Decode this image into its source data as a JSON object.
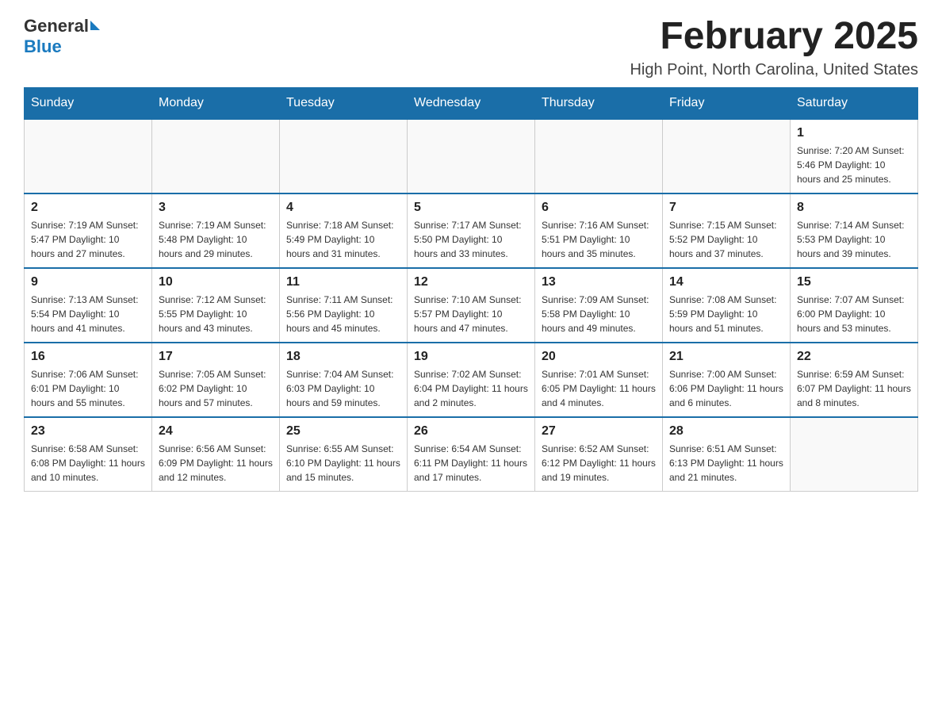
{
  "header": {
    "logo_general": "General",
    "logo_blue": "Blue",
    "month_title": "February 2025",
    "location": "High Point, North Carolina, United States"
  },
  "calendar": {
    "days_of_week": [
      "Sunday",
      "Monday",
      "Tuesday",
      "Wednesday",
      "Thursday",
      "Friday",
      "Saturday"
    ],
    "weeks": [
      [
        {
          "day": "",
          "info": ""
        },
        {
          "day": "",
          "info": ""
        },
        {
          "day": "",
          "info": ""
        },
        {
          "day": "",
          "info": ""
        },
        {
          "day": "",
          "info": ""
        },
        {
          "day": "",
          "info": ""
        },
        {
          "day": "1",
          "info": "Sunrise: 7:20 AM\nSunset: 5:46 PM\nDaylight: 10 hours and 25 minutes."
        }
      ],
      [
        {
          "day": "2",
          "info": "Sunrise: 7:19 AM\nSunset: 5:47 PM\nDaylight: 10 hours and 27 minutes."
        },
        {
          "day": "3",
          "info": "Sunrise: 7:19 AM\nSunset: 5:48 PM\nDaylight: 10 hours and 29 minutes."
        },
        {
          "day": "4",
          "info": "Sunrise: 7:18 AM\nSunset: 5:49 PM\nDaylight: 10 hours and 31 minutes."
        },
        {
          "day": "5",
          "info": "Sunrise: 7:17 AM\nSunset: 5:50 PM\nDaylight: 10 hours and 33 minutes."
        },
        {
          "day": "6",
          "info": "Sunrise: 7:16 AM\nSunset: 5:51 PM\nDaylight: 10 hours and 35 minutes."
        },
        {
          "day": "7",
          "info": "Sunrise: 7:15 AM\nSunset: 5:52 PM\nDaylight: 10 hours and 37 minutes."
        },
        {
          "day": "8",
          "info": "Sunrise: 7:14 AM\nSunset: 5:53 PM\nDaylight: 10 hours and 39 minutes."
        }
      ],
      [
        {
          "day": "9",
          "info": "Sunrise: 7:13 AM\nSunset: 5:54 PM\nDaylight: 10 hours and 41 minutes."
        },
        {
          "day": "10",
          "info": "Sunrise: 7:12 AM\nSunset: 5:55 PM\nDaylight: 10 hours and 43 minutes."
        },
        {
          "day": "11",
          "info": "Sunrise: 7:11 AM\nSunset: 5:56 PM\nDaylight: 10 hours and 45 minutes."
        },
        {
          "day": "12",
          "info": "Sunrise: 7:10 AM\nSunset: 5:57 PM\nDaylight: 10 hours and 47 minutes."
        },
        {
          "day": "13",
          "info": "Sunrise: 7:09 AM\nSunset: 5:58 PM\nDaylight: 10 hours and 49 minutes."
        },
        {
          "day": "14",
          "info": "Sunrise: 7:08 AM\nSunset: 5:59 PM\nDaylight: 10 hours and 51 minutes."
        },
        {
          "day": "15",
          "info": "Sunrise: 7:07 AM\nSunset: 6:00 PM\nDaylight: 10 hours and 53 minutes."
        }
      ],
      [
        {
          "day": "16",
          "info": "Sunrise: 7:06 AM\nSunset: 6:01 PM\nDaylight: 10 hours and 55 minutes."
        },
        {
          "day": "17",
          "info": "Sunrise: 7:05 AM\nSunset: 6:02 PM\nDaylight: 10 hours and 57 minutes."
        },
        {
          "day": "18",
          "info": "Sunrise: 7:04 AM\nSunset: 6:03 PM\nDaylight: 10 hours and 59 minutes."
        },
        {
          "day": "19",
          "info": "Sunrise: 7:02 AM\nSunset: 6:04 PM\nDaylight: 11 hours and 2 minutes."
        },
        {
          "day": "20",
          "info": "Sunrise: 7:01 AM\nSunset: 6:05 PM\nDaylight: 11 hours and 4 minutes."
        },
        {
          "day": "21",
          "info": "Sunrise: 7:00 AM\nSunset: 6:06 PM\nDaylight: 11 hours and 6 minutes."
        },
        {
          "day": "22",
          "info": "Sunrise: 6:59 AM\nSunset: 6:07 PM\nDaylight: 11 hours and 8 minutes."
        }
      ],
      [
        {
          "day": "23",
          "info": "Sunrise: 6:58 AM\nSunset: 6:08 PM\nDaylight: 11 hours and 10 minutes."
        },
        {
          "day": "24",
          "info": "Sunrise: 6:56 AM\nSunset: 6:09 PM\nDaylight: 11 hours and 12 minutes."
        },
        {
          "day": "25",
          "info": "Sunrise: 6:55 AM\nSunset: 6:10 PM\nDaylight: 11 hours and 15 minutes."
        },
        {
          "day": "26",
          "info": "Sunrise: 6:54 AM\nSunset: 6:11 PM\nDaylight: 11 hours and 17 minutes."
        },
        {
          "day": "27",
          "info": "Sunrise: 6:52 AM\nSunset: 6:12 PM\nDaylight: 11 hours and 19 minutes."
        },
        {
          "day": "28",
          "info": "Sunrise: 6:51 AM\nSunset: 6:13 PM\nDaylight: 11 hours and 21 minutes."
        },
        {
          "day": "",
          "info": ""
        }
      ]
    ]
  }
}
